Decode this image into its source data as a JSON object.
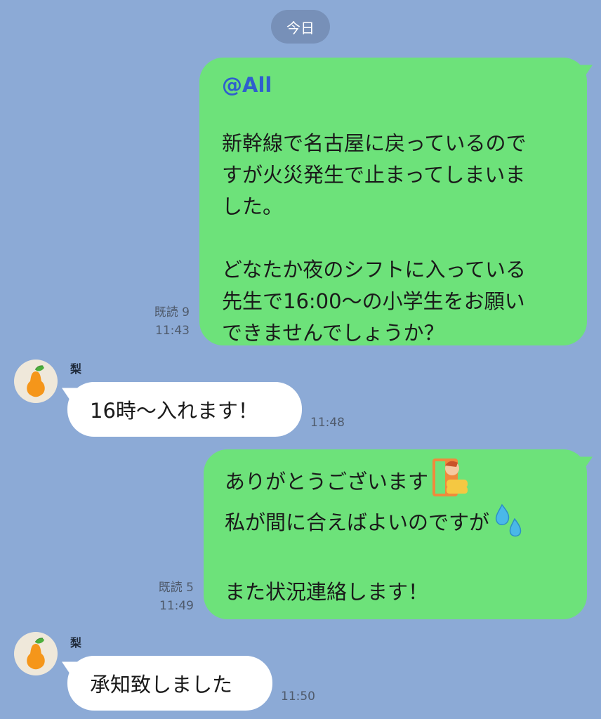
{
  "date_label": "今日",
  "messages": {
    "m1": {
      "mention": "@All",
      "line1": "新幹線で名古屋に戻っているので",
      "line2": "すが火災発生で止まってしまいま",
      "line3": "した。",
      "line4": "どなたか夜のシフトに入っている",
      "line5": "先生で16:00〜の小学生をお願い",
      "line6": "できませんでしょうか？",
      "read": "既読 9",
      "time": "11:43"
    },
    "m2": {
      "sender": "梨",
      "text": "16時〜入れます！",
      "time": "11:48"
    },
    "m3": {
      "line1": "ありがとうございます",
      "line2": "私が間に合えばよいのですが",
      "line3": "また状況連絡します！",
      "read": "既読 5",
      "time": "11:49"
    },
    "m4": {
      "sender": "梨",
      "text": "承知致しました",
      "time": "11:50"
    }
  },
  "icons": {
    "avatar": "pear-icon",
    "emoji1": "bowing-person-emoji",
    "emoji2": "sweat-drops-emoji"
  },
  "colors": {
    "background": "#8caad6",
    "outgoing_bubble": "#6de27a",
    "incoming_bubble": "#ffffff",
    "mention": "#2f5fce"
  }
}
